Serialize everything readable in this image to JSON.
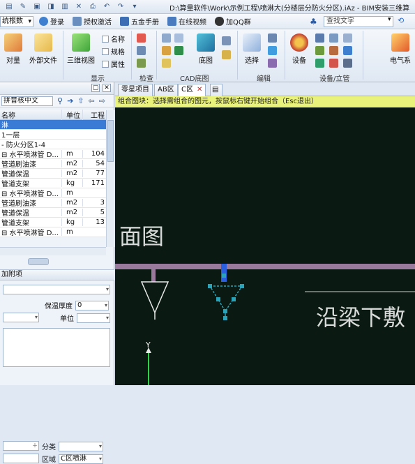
{
  "title_bar": {
    "path": "D:\\算量软件\\Work\\示例工程\\喷淋大(分楼层分防火分区).iAz - BIM安装三维算"
  },
  "menu": {
    "doc_select": "统根数",
    "items": [
      {
        "label": "登录"
      },
      {
        "label": "授权激活"
      },
      {
        "label": "五金手册"
      },
      {
        "label": "在线视频"
      },
      {
        "label": "加QQ群"
      }
    ],
    "search_placeholder": "查找文字"
  },
  "ribbon": {
    "buttons": {
      "compare": "对量",
      "external_file": "外部文件",
      "view3d": "三维视图",
      "name": "名称",
      "spec": "规格",
      "attribute": "属性",
      "base_map": "底图",
      "select": "选择",
      "equipment": "设备",
      "electric": "电气系"
    },
    "groups": {
      "display": "显示",
      "check": "检查",
      "cad_base": "CAD底图",
      "edit": "编辑",
      "equipment_riser": "设备/立管"
    }
  },
  "left_panel": {
    "search_text": "拼音核中文",
    "columns": {
      "name": "名称",
      "unit": "单位",
      "qty": "工程"
    },
    "rows": [
      {
        "name": "淋",
        "unit": "",
        "qty": "",
        "selected": true
      },
      {
        "name": "1一层",
        "unit": "",
        "qty": ""
      },
      {
        "name": "- 防火分区1-4",
        "unit": "",
        "qty": ""
      },
      {
        "name": "⊟ 水平喷淋管 D...",
        "unit": "m",
        "qty": "104"
      },
      {
        "name": "    管道刷油漆",
        "unit": "m2",
        "qty": "54"
      },
      {
        "name": "    管道保温",
        "unit": "m2",
        "qty": "77"
      },
      {
        "name": "    管道支架",
        "unit": "kg",
        "qty": "171"
      },
      {
        "name": "⊟ 水平喷淋管 D...",
        "unit": "m",
        "qty": ""
      },
      {
        "name": "    管道刷油漆",
        "unit": "m2",
        "qty": "3"
      },
      {
        "name": "    管道保温",
        "unit": "m2",
        "qty": "5"
      },
      {
        "name": "    管道支架",
        "unit": "kg",
        "qty": "13"
      },
      {
        "name": "⊟ 水平喷淋管 D...",
        "unit": "m",
        "qty": ""
      }
    ],
    "prop_tab": "加附项",
    "props": {
      "insulation_label": "保温厚度",
      "insulation_value": "0",
      "unit_label": "单位",
      "category_label": "分类",
      "region_label": "区域",
      "region_value": "C区喷淋"
    }
  },
  "doc_tabs": [
    {
      "label": "零星项目"
    },
    {
      "label": "AB区"
    },
    {
      "label": "C区",
      "active": true
    }
  ],
  "status_message": "组合图块：选择需组合的图元，按鼠标右键开始组合（Esc退出）",
  "canvas": {
    "label_left": "面图",
    "label_right": "沿梁下敷",
    "axis_label": "Y",
    "colors": {
      "background": "#0a1a12",
      "pipe": "#9a7a9c",
      "selection": "#2aa3b8"
    }
  }
}
